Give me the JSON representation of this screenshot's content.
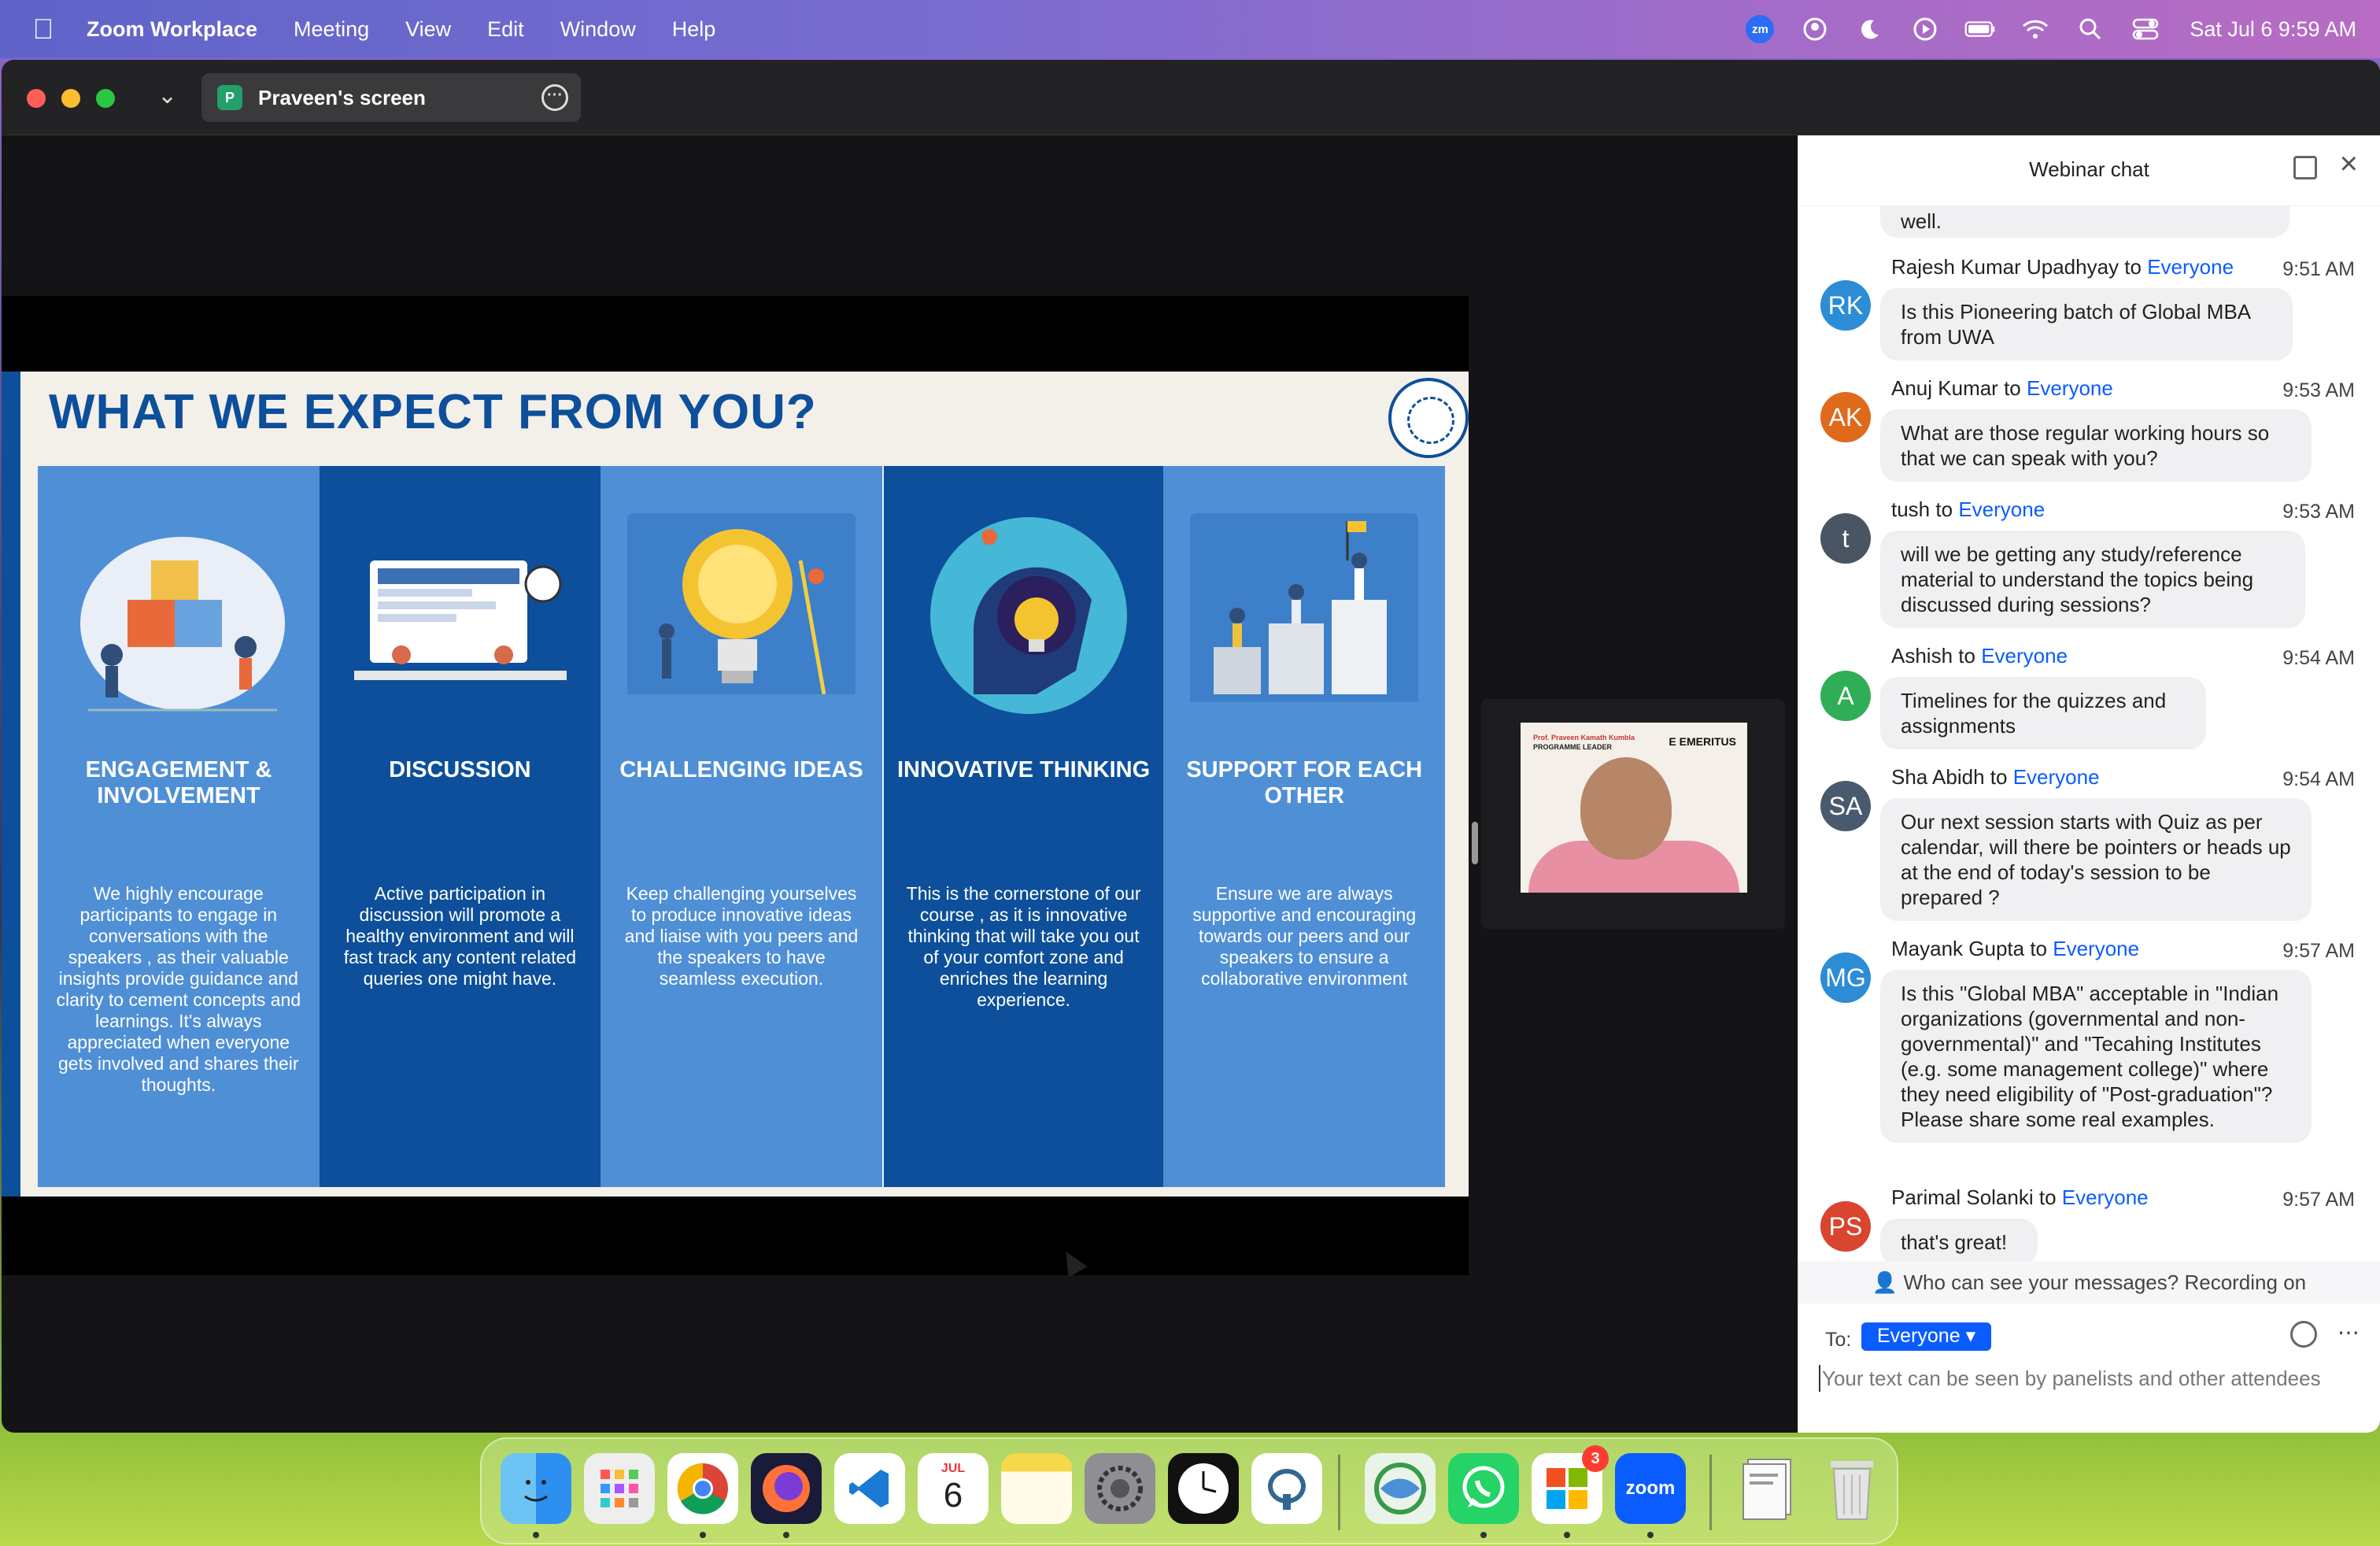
{
  "menubar": {
    "app_name": "Zoom Workplace",
    "menus": [
      "Meeting",
      "View",
      "Edit",
      "Window",
      "Help"
    ],
    "zm_icon": "zm",
    "datetime": "Sat Jul 6  9:59 AM",
    "status_icons": [
      "zoom-icon",
      "user-circle-icon",
      "moon-icon",
      "play-circle-icon",
      "battery-icon",
      "wifi-icon",
      "search-icon",
      "control-center-icon"
    ]
  },
  "window": {
    "share_initial": "P",
    "share_title": "Praveen's screen",
    "more_glyph": "···"
  },
  "slide": {
    "title": "WHAT WE EXPECT FROM YOU?",
    "columns": [
      {
        "title": "ENGAGEMENT & INVOLVEMENT",
        "text": "We highly encourage participants to engage in conversations with the speakers , as their valuable insights provide guidance and clarity to cement concepts and learnings. It's always appreciated when everyone gets involved and shares their thoughts."
      },
      {
        "title": "DISCUSSION",
        "text": "Active participation in discussion will promote a healthy environment and will fast track any content related queries one might have."
      },
      {
        "title": "CHALLENGING IDEAS",
        "text": "Keep challenging yourselves to produce innovative ideas and liaise with you peers and the speakers to have seamless execution."
      },
      {
        "title": "INNOVATIVE THINKING",
        "text": "This is the cornerstone of our course , as it is innovative thinking that will take you out of your comfort zone and enriches the learning experience."
      },
      {
        "title": "SUPPORT FOR EACH OTHER",
        "text": "Ensure we are always supportive and encouraging towards our peers and our speakers to ensure a collaborative environment"
      }
    ]
  },
  "video": {
    "name_line": "Prof. Praveen Kamath Kumbla",
    "role_line": "PROGRAMME LEADER",
    "brand": "E EMERITUS"
  },
  "chat": {
    "title": "Webinar chat",
    "previous_tail": "well.",
    "to_word": "to",
    "messages": [
      {
        "initials": "RK",
        "color": "#2d8cd6",
        "sender": "Rajesh Kumar Upadhyay",
        "to": "Everyone",
        "time": "9:51 AM",
        "text": "Is this Pioneering batch of Global MBA from UWA"
      },
      {
        "initials": "AK",
        "color": "#e06a1c",
        "sender": "Anuj Kumar",
        "to": "Everyone",
        "time": "9:53 AM",
        "text": "What are those regular working hours so that we can speak with you?"
      },
      {
        "initials": "t",
        "color": "#4a5563",
        "sender": "tush",
        "to": "Everyone",
        "time": "9:53 AM",
        "text": "will we be getting any study/reference material to understand the topics being discussed during sessions?"
      },
      {
        "initials": "A",
        "color": "#2fae57",
        "sender": "Ashish",
        "to": "Everyone",
        "time": "9:54 AM",
        "text": "Timelines for the quizzes and assignments"
      },
      {
        "initials": "SA",
        "color": "#4a5a6e",
        "sender": "Sha Abidh",
        "to": "Everyone",
        "time": "9:54 AM",
        "text": "Our next session starts with Quiz as per calendar, will there be pointers or heads up at the end of today's session to be prepared ?"
      },
      {
        "initials": "MG",
        "color": "#2d8cd6",
        "sender": "Mayank Gupta",
        "to": "Everyone",
        "time": "9:57 AM",
        "text": "Is this \"Global MBA\" acceptable in \"Indian organizations (governmental and non-governmental)\" and \"Tecahing Institutes (e.g. some management college)\" where they need eligibility of \"Post-graduation\"? Please share some real examples."
      },
      {
        "initials": "PS",
        "color": "#d9452e",
        "sender": "Parimal Solanki",
        "to": "Everyone",
        "time": "9:57 AM",
        "text": "that's great!"
      }
    ],
    "privacy_notice": "Who can see your messages? Recording on",
    "to_label": "To:",
    "recipient": "Everyone",
    "input_placeholder": "Your text can be seen by panelists and other attendees"
  },
  "dock": {
    "apps": [
      "Finder",
      "Launchpad",
      "Chrome",
      "Firefox",
      "VS Code",
      "Calendar",
      "Notes",
      "System Settings",
      "Clock",
      "pgAdmin",
      "Browser",
      "WhatsApp",
      "Microsoft",
      "Zoom",
      "Files",
      "Trash"
    ],
    "calendar_month": "JUL",
    "calendar_day": "6",
    "zoom_label": "zoom",
    "badge_count": "3"
  }
}
